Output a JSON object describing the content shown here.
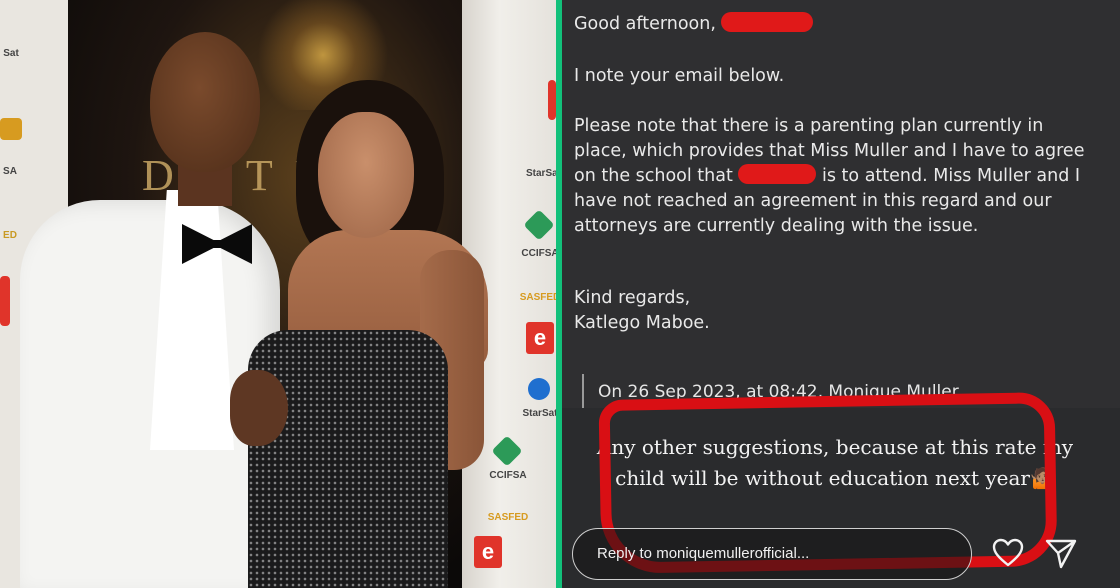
{
  "photo": {
    "backdrop_word": "D  E  T  U",
    "sponsors": {
      "left_top": "Sat",
      "left_mid": "SA",
      "left_low": "ED",
      "right_1": "StarSat",
      "right_2": "CCIFSA",
      "right_3": "SASFED",
      "right_4": "StarSat",
      "right_5": "CCIFSA",
      "right_6": "SASFED",
      "e_badge": "e"
    }
  },
  "email": {
    "greeting": "Good afternoon,",
    "note": "I note your email below.",
    "body_part1": "Please note that there is a parenting plan currently in place, which provides that Miss Muller and I have to agree on the school that",
    "body_part2": "is to attend. Miss Muller and I have not reached an agreement in this regard and our attorneys are currently dealing with the issue.",
    "closing": "Kind regards,",
    "signature": "Katlego Maboe.",
    "quote_header": "On 26 Sep 2023, at 08:42, Monique Muller"
  },
  "story": {
    "reply_message": "Any other suggestions, because at this rate my child will be without education next year🤷🏽",
    "reply_placeholder": "Reply to moniquemullerofficial...",
    "icons": [
      "heart-icon",
      "send-icon"
    ]
  },
  "colors": {
    "divider": "#12c07a",
    "redaction": "#e01919",
    "annotation": "#d90f14",
    "email_bg": "#2f2f31"
  }
}
